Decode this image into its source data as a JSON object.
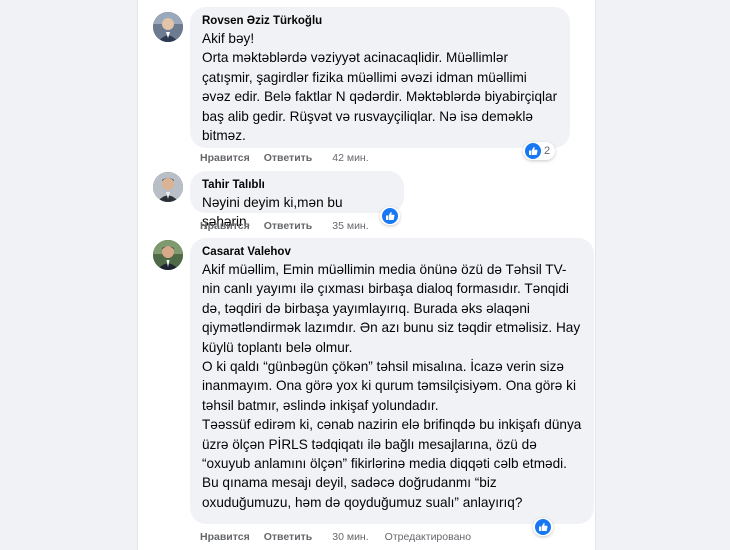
{
  "comments": [
    {
      "author": "Rovsen Əziz Türkoğlu",
      "text": "Akif bəy!\nOrta məktəblərdə vəziyyət acinacaqlidir. Müəllimlər çatışmir, şagirdlər fizika müəllimi əvəzi idman müəllimi əvəz edir. Belə faktlar N qədərdir. Məktəblərdə biyabirçiqlar baş alib gedir. Rüşvət və rusvayçiliqlar. Nə isə deməklə bitməz.",
      "like_label": "Нравится",
      "reply_label": "Ответить",
      "time": "42 мин.",
      "reaction_count": "2",
      "reaction_icon": "like-icon"
    },
    {
      "author": "Tahir Talıblı",
      "text": "Nəyini deyim ki,mən bu şəhərin.",
      "like_label": "Нравится",
      "reply_label": "Ответить",
      "time": "35 мин.",
      "reaction_icon": "like-icon"
    },
    {
      "author": "Casarat Valehov",
      "text": "Akif müəllim, Emin müəllimin media önünə özü də Təhsil TV-nin canlı yayımı ilə çıxması birbaşa dialoq formasıdır. Tənqidi də, təqdiri də birbaşa yayımlayırıq. Burada əks əlaqəni qiymətləndirmək lazımdır. Ən azı bunu siz təqdir etməlisiz. Hay küylü toplantı belə olmur.\nO ki qaldı “günbəgün çökən” təhsil misalına. İcazə verin sizə inanmayım. Ona görə yox ki qurum təmsilçisiyəm. Ona görə ki təhsil batmır, əslində inkişaf yolundadır.\nTəəssüf edirəm ki, cənab nazirin elə brifinqdə bu inkişafı dünya üzrə ölçən PİRLS tədqiqatı ilə bağlı mesajlarına, özü də “oxuyub anlamını ölçən” fikirlərinə media diqqəti cəlb etmədi.\nBu qınama mesajı deyil, sadəcə doğrudanmı “biz oxuduğumuzu, həm də qoyduğumuz sualı” anlayırıq?",
      "like_label": "Нравится",
      "reply_label": "Ответить",
      "time": "30 мин.",
      "edited_label": "Отредактировано",
      "reaction_icon": "like-icon"
    }
  ],
  "colors": {
    "page_bg": "#f0f2f5",
    "bubble_bg": "#f0f2f5",
    "text": "#050505",
    "meta": "#65676b",
    "like_blue": "#1877f2"
  }
}
